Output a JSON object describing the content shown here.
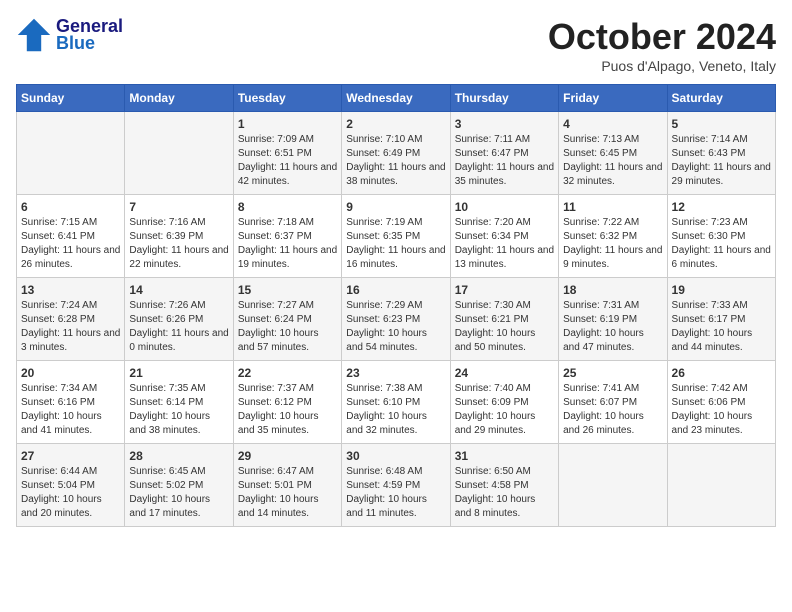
{
  "header": {
    "logo_line1": "General",
    "logo_line2": "Blue",
    "month": "October 2024",
    "location": "Puos d'Alpago, Veneto, Italy"
  },
  "days_of_week": [
    "Sunday",
    "Monday",
    "Tuesday",
    "Wednesday",
    "Thursday",
    "Friday",
    "Saturday"
  ],
  "weeks": [
    [
      {
        "day": "",
        "info": ""
      },
      {
        "day": "",
        "info": ""
      },
      {
        "day": "1",
        "info": "Sunrise: 7:09 AM\nSunset: 6:51 PM\nDaylight: 11 hours and 42 minutes."
      },
      {
        "day": "2",
        "info": "Sunrise: 7:10 AM\nSunset: 6:49 PM\nDaylight: 11 hours and 38 minutes."
      },
      {
        "day": "3",
        "info": "Sunrise: 7:11 AM\nSunset: 6:47 PM\nDaylight: 11 hours and 35 minutes."
      },
      {
        "day": "4",
        "info": "Sunrise: 7:13 AM\nSunset: 6:45 PM\nDaylight: 11 hours and 32 minutes."
      },
      {
        "day": "5",
        "info": "Sunrise: 7:14 AM\nSunset: 6:43 PM\nDaylight: 11 hours and 29 minutes."
      }
    ],
    [
      {
        "day": "6",
        "info": "Sunrise: 7:15 AM\nSunset: 6:41 PM\nDaylight: 11 hours and 26 minutes."
      },
      {
        "day": "7",
        "info": "Sunrise: 7:16 AM\nSunset: 6:39 PM\nDaylight: 11 hours and 22 minutes."
      },
      {
        "day": "8",
        "info": "Sunrise: 7:18 AM\nSunset: 6:37 PM\nDaylight: 11 hours and 19 minutes."
      },
      {
        "day": "9",
        "info": "Sunrise: 7:19 AM\nSunset: 6:35 PM\nDaylight: 11 hours and 16 minutes."
      },
      {
        "day": "10",
        "info": "Sunrise: 7:20 AM\nSunset: 6:34 PM\nDaylight: 11 hours and 13 minutes."
      },
      {
        "day": "11",
        "info": "Sunrise: 7:22 AM\nSunset: 6:32 PM\nDaylight: 11 hours and 9 minutes."
      },
      {
        "day": "12",
        "info": "Sunrise: 7:23 AM\nSunset: 6:30 PM\nDaylight: 11 hours and 6 minutes."
      }
    ],
    [
      {
        "day": "13",
        "info": "Sunrise: 7:24 AM\nSunset: 6:28 PM\nDaylight: 11 hours and 3 minutes."
      },
      {
        "day": "14",
        "info": "Sunrise: 7:26 AM\nSunset: 6:26 PM\nDaylight: 11 hours and 0 minutes."
      },
      {
        "day": "15",
        "info": "Sunrise: 7:27 AM\nSunset: 6:24 PM\nDaylight: 10 hours and 57 minutes."
      },
      {
        "day": "16",
        "info": "Sunrise: 7:29 AM\nSunset: 6:23 PM\nDaylight: 10 hours and 54 minutes."
      },
      {
        "day": "17",
        "info": "Sunrise: 7:30 AM\nSunset: 6:21 PM\nDaylight: 10 hours and 50 minutes."
      },
      {
        "day": "18",
        "info": "Sunrise: 7:31 AM\nSunset: 6:19 PM\nDaylight: 10 hours and 47 minutes."
      },
      {
        "day": "19",
        "info": "Sunrise: 7:33 AM\nSunset: 6:17 PM\nDaylight: 10 hours and 44 minutes."
      }
    ],
    [
      {
        "day": "20",
        "info": "Sunrise: 7:34 AM\nSunset: 6:16 PM\nDaylight: 10 hours and 41 minutes."
      },
      {
        "day": "21",
        "info": "Sunrise: 7:35 AM\nSunset: 6:14 PM\nDaylight: 10 hours and 38 minutes."
      },
      {
        "day": "22",
        "info": "Sunrise: 7:37 AM\nSunset: 6:12 PM\nDaylight: 10 hours and 35 minutes."
      },
      {
        "day": "23",
        "info": "Sunrise: 7:38 AM\nSunset: 6:10 PM\nDaylight: 10 hours and 32 minutes."
      },
      {
        "day": "24",
        "info": "Sunrise: 7:40 AM\nSunset: 6:09 PM\nDaylight: 10 hours and 29 minutes."
      },
      {
        "day": "25",
        "info": "Sunrise: 7:41 AM\nSunset: 6:07 PM\nDaylight: 10 hours and 26 minutes."
      },
      {
        "day": "26",
        "info": "Sunrise: 7:42 AM\nSunset: 6:06 PM\nDaylight: 10 hours and 23 minutes."
      }
    ],
    [
      {
        "day": "27",
        "info": "Sunrise: 6:44 AM\nSunset: 5:04 PM\nDaylight: 10 hours and 20 minutes."
      },
      {
        "day": "28",
        "info": "Sunrise: 6:45 AM\nSunset: 5:02 PM\nDaylight: 10 hours and 17 minutes."
      },
      {
        "day": "29",
        "info": "Sunrise: 6:47 AM\nSunset: 5:01 PM\nDaylight: 10 hours and 14 minutes."
      },
      {
        "day": "30",
        "info": "Sunrise: 6:48 AM\nSunset: 4:59 PM\nDaylight: 10 hours and 11 minutes."
      },
      {
        "day": "31",
        "info": "Sunrise: 6:50 AM\nSunset: 4:58 PM\nDaylight: 10 hours and 8 minutes."
      },
      {
        "day": "",
        "info": ""
      },
      {
        "day": "",
        "info": ""
      }
    ]
  ]
}
